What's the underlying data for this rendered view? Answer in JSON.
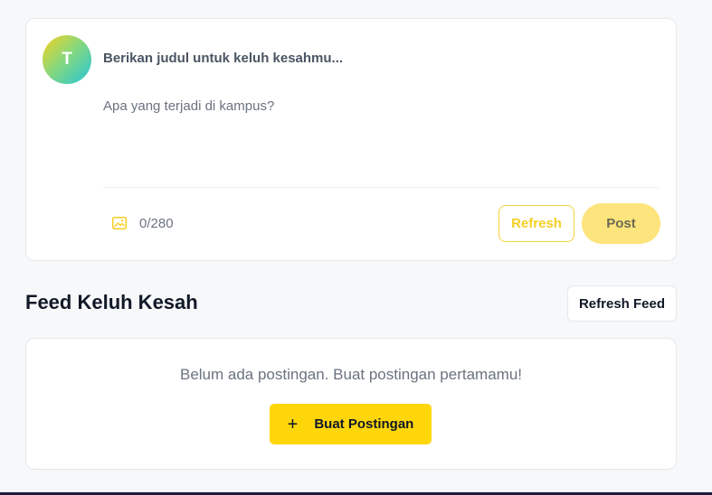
{
  "composer": {
    "avatar_initial": "T",
    "title_placeholder": "Berikan judul untuk keluh kesahmu...",
    "body_placeholder": "Apa yang terjadi di kampus?",
    "char_count": "0/280",
    "refresh_label": "Refresh",
    "post_label": "Post",
    "image_icon": "image-icon"
  },
  "feed": {
    "title": "Feed Keluh Kesah",
    "refresh_label": "Refresh Feed",
    "empty_message": "Belum ada postingan. Buat postingan pertamamu!",
    "create_label": "Buat Postingan",
    "create_icon": "plus-icon"
  },
  "colors": {
    "accent": "#ffd60a",
    "post_disabled": "#fde47c",
    "refresh_outline": "#f5d43a",
    "bottom_bar": "#1f1a3f"
  }
}
